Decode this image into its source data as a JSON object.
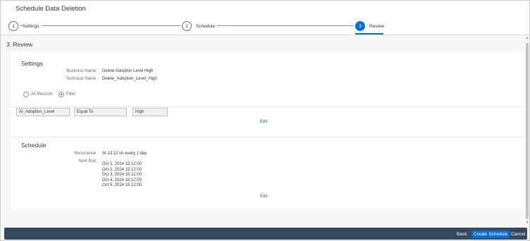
{
  "dialog": {
    "title": "Schedule Data Deletion"
  },
  "wizard": {
    "steps": [
      {
        "number": "1",
        "label": "Settings"
      },
      {
        "number": "2",
        "label": "Schedule"
      },
      {
        "number": "3",
        "label": "Review"
      }
    ]
  },
  "review": {
    "heading": "3. Review",
    "settings": {
      "title": "Settings",
      "business_name_label": "Business Name:",
      "business_name_value": "Delete Adoption Level High",
      "technical_name_label": "Technical Name:",
      "technical_name_value": "Delete_Adoption_Level_High",
      "radio_all_records": "All Records",
      "radio_filter": "Filter",
      "filter": {
        "column": "AI_Adoption_Level",
        "operator": "Equal To",
        "value": "High"
      },
      "edit_label": "Edit"
    },
    "schedule": {
      "title": "Schedule",
      "recurrence_label": "Recurrence:",
      "recurrence_value": "At 13:12 on every 1 day",
      "next_run_label": "Next Run:",
      "next_runs": [
        "Oct 1, 2024 15:12:00",
        "Oct 2, 2024 15:12:00",
        "Oct 3, 2024 15:12:00",
        "Oct 4, 2024 15:12:00",
        "Oct 5, 2024 15:12:00"
      ],
      "edit_label": "Edit"
    }
  },
  "footer": {
    "back_label": "Back",
    "create_label": "Create Schedule",
    "cancel_label": "Cancel"
  },
  "colors": {
    "accent": "#0a6ed1",
    "footer_bg": "#354a5f"
  }
}
